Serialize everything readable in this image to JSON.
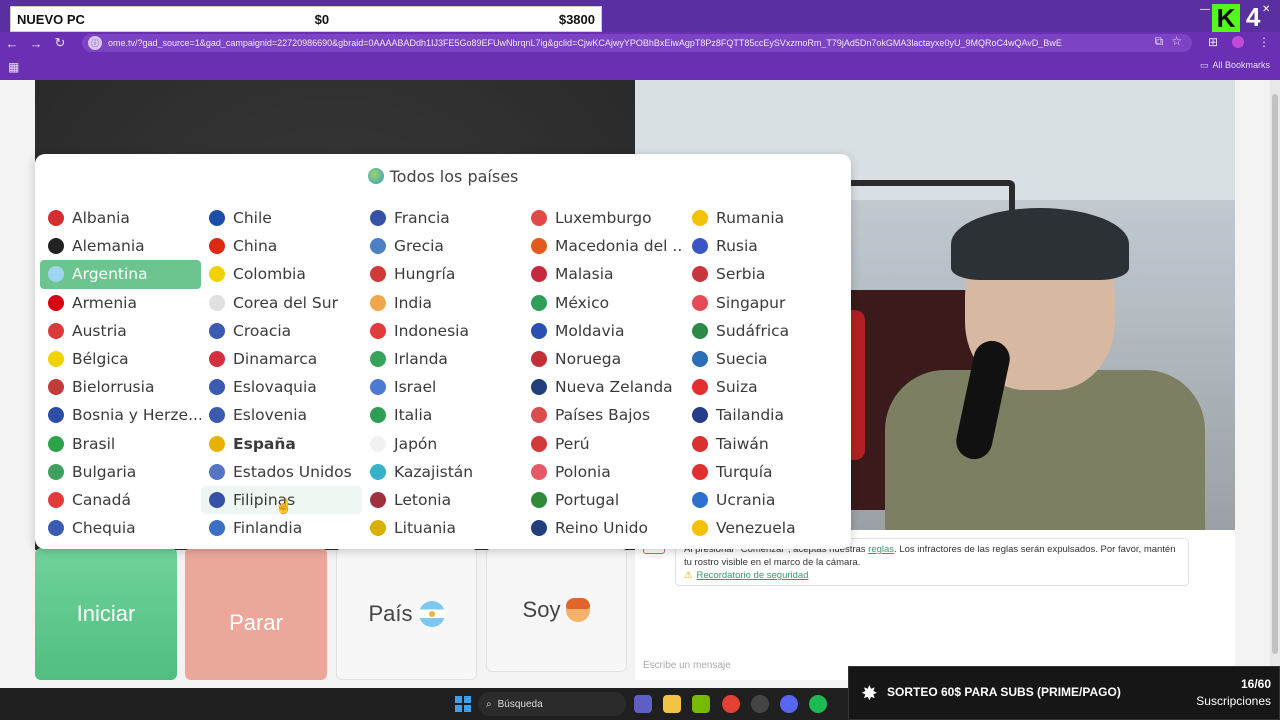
{
  "goal": {
    "title": "NUEVO PC",
    "current": "$0",
    "target": "$3800"
  },
  "browser": {
    "url": "ome.tv/?gad_source=1&gad_campaignid=22720986690&gbraid=0AAAABADdh1IJ3FE5Go89EFUwNbrqnL7ig&gclid=CjwKCAjwyYPOBhBxEiwAgpT8Pz8FQTT85ccEySVxzmoRm_T79jAd5Dn7okGMA3lactayxe0yU_9MQRoC4wQAvD_BwE",
    "bookmarks_label": "All Bookmarks"
  },
  "streamer_badge": {
    "letter": "K",
    "number": "4"
  },
  "popup": {
    "title": "Todos los países",
    "countries": [
      {
        "name": "Albania",
        "color": "#d32f2f"
      },
      {
        "name": "Chile",
        "color": "#1e4fa8"
      },
      {
        "name": "Francia",
        "color": "#3552a6"
      },
      {
        "name": "Luxemburgo",
        "color": "#e24a4a"
      },
      {
        "name": "Rumania",
        "color": "#f2c200"
      },
      {
        "name": "Alemania",
        "color": "#222222"
      },
      {
        "name": "China",
        "color": "#de2910"
      },
      {
        "name": "Grecia",
        "color": "#4c7fc3"
      },
      {
        "name": "Macedonia del ...",
        "color": "#e35b1c"
      },
      {
        "name": "Rusia",
        "color": "#3b56c4"
      },
      {
        "name": "Argentina",
        "color": "#9fd4f0"
      },
      {
        "name": "Colombia",
        "color": "#f2d100"
      },
      {
        "name": "Hungría",
        "color": "#d23a3a"
      },
      {
        "name": "Malasia",
        "color": "#c8283e"
      },
      {
        "name": "Serbia",
        "color": "#c6363c"
      },
      {
        "name": "Armenia",
        "color": "#d90012"
      },
      {
        "name": "Corea del Sur",
        "color": "#e0e0e0"
      },
      {
        "name": "India",
        "color": "#f0a64a"
      },
      {
        "name": "México",
        "color": "#2e9e5a"
      },
      {
        "name": "Singapur",
        "color": "#e54b57"
      },
      {
        "name": "Austria",
        "color": "#d93b3b"
      },
      {
        "name": "Croacia",
        "color": "#3b5bb0"
      },
      {
        "name": "Indonesia",
        "color": "#e23b3b"
      },
      {
        "name": "Moldavia",
        "color": "#2a4fb0"
      },
      {
        "name": "Sudáfrica",
        "color": "#2b8a46"
      },
      {
        "name": "Bélgica",
        "color": "#f2d100"
      },
      {
        "name": "Dinamarca",
        "color": "#d32f3f"
      },
      {
        "name": "Irlanda",
        "color": "#36a35a"
      },
      {
        "name": "Noruega",
        "color": "#c2303a"
      },
      {
        "name": "Suecia",
        "color": "#2b6fb6"
      },
      {
        "name": "Bielorrusia",
        "color": "#c23b3b"
      },
      {
        "name": "Eslovaquia",
        "color": "#3b5bb0"
      },
      {
        "name": "Israel",
        "color": "#4d7bd2"
      },
      {
        "name": "Nueva Zelanda",
        "color": "#233d7a"
      },
      {
        "name": "Suiza",
        "color": "#e23030"
      },
      {
        "name": "Bosnia y Herze...",
        "color": "#2c4ea8"
      },
      {
        "name": "Eslovenia",
        "color": "#3b5bb0"
      },
      {
        "name": "Italia",
        "color": "#2f9e55"
      },
      {
        "name": "Países Bajos",
        "color": "#d94d4d"
      },
      {
        "name": "Tailandia",
        "color": "#263d8a"
      },
      {
        "name": "Brasil",
        "color": "#2ea24a"
      },
      {
        "name": "España",
        "color": "#e5b300"
      },
      {
        "name": "Japón",
        "color": "#f1f1f1"
      },
      {
        "name": "Perú",
        "color": "#d23a3a"
      },
      {
        "name": "Taiwán",
        "color": "#d93030"
      },
      {
        "name": "Bulgaria",
        "color": "#40a060"
      },
      {
        "name": "Estados Unidos",
        "color": "#5674c6"
      },
      {
        "name": "Kazajistán",
        "color": "#35b3c8"
      },
      {
        "name": "Polonia",
        "color": "#e45a66"
      },
      {
        "name": "Turquía",
        "color": "#e03030"
      },
      {
        "name": "Canadá",
        "color": "#e23b3b"
      },
      {
        "name": "Filipinas",
        "color": "#3552a6"
      },
      {
        "name": "Letonia",
        "color": "#9e3040"
      },
      {
        "name": "Portugal",
        "color": "#2f8a3a"
      },
      {
        "name": "Ucrania",
        "color": "#2f6fd0"
      },
      {
        "name": "Chequia",
        "color": "#3b5bb0"
      },
      {
        "name": "Finlandia",
        "color": "#3b6fc6"
      },
      {
        "name": "Lituania",
        "color": "#d8b000"
      },
      {
        "name": "Reino Unido",
        "color": "#233d7a"
      },
      {
        "name": "Venezuela",
        "color": "#f2c200"
      }
    ]
  },
  "chat": {
    "notice": "Al presionar \"Comenzar\", aceptas nuestras",
    "rules_link": "reglas",
    "notice_rest": ". Los infractores de las reglas serán expulsados. Por favor, mantén tu rostro visible en el marco de la cámara.",
    "safety_link": "Recordatorio de seguridad",
    "input_placeholder": "Escribe un mensaje"
  },
  "controls": {
    "start": "Iniciar",
    "stop": "Parar",
    "country": "País",
    "me": "Soy"
  },
  "taskbar": {
    "search_label": "Búsqueda"
  },
  "giveaway": {
    "text": "SORTEO 60$ PARA SUBS (PRIME/PAGO)",
    "count": "16/60",
    "label": "Suscripciones"
  }
}
